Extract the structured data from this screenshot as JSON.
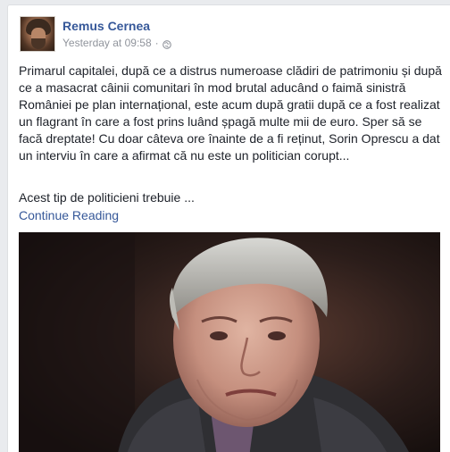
{
  "post": {
    "author": "Remus Cernea",
    "timestamp": "Yesterday at 09:58",
    "separator": "·",
    "privacy_icon": "globe-icon",
    "body": "Primarul capitalei, după ce a distrus numeroase clădiri de patrimoniu și după ce a masacrat câinii comunitari în mod brutal aducând o faimă sinistră României pe plan internațional, este acum după gratii după ce a fost realizat un flagrant în care a fost prins luând șpagă multe mii de euro. Sper să se facă dreptate! Cu doar câteva ore înainte de a fi reținut, Sorin Oprescu a dat un interviu în care a afirmat că nu este un politician corupt...",
    "teaser": "Acest tip de politicieni trebuie ...",
    "continue_label": "Continue Reading"
  },
  "colors": {
    "link": "#365899",
    "text": "#1d2129",
    "muted": "#90949c"
  }
}
